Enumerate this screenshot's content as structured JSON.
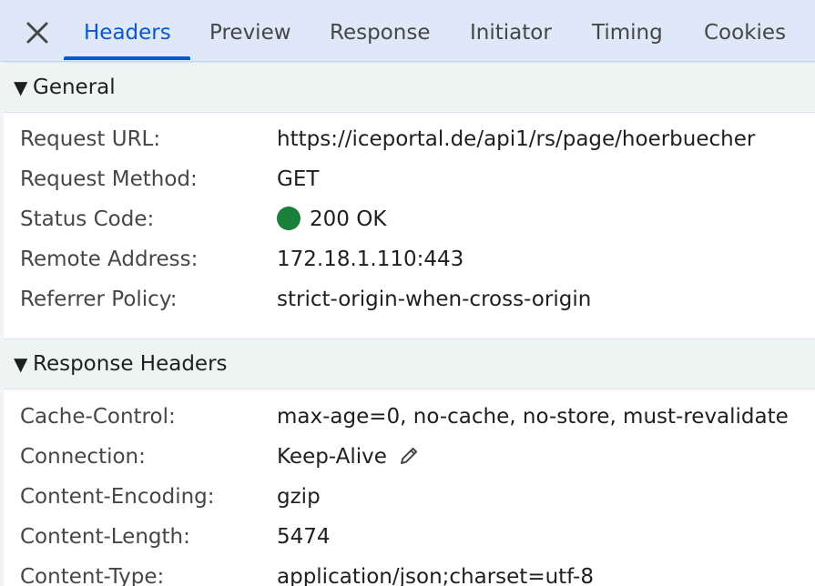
{
  "tabs": [
    {
      "label": "Headers"
    },
    {
      "label": "Preview"
    },
    {
      "label": "Response"
    },
    {
      "label": "Initiator"
    },
    {
      "label": "Timing"
    },
    {
      "label": "Cookies"
    }
  ],
  "general": {
    "title": "General",
    "triangle": "▼",
    "rows": [
      {
        "key": "Request URL:",
        "value": "https://iceportal.de/api1/rs/page/hoerbuecher"
      },
      {
        "key": "Request Method:",
        "value": "GET"
      },
      {
        "key": "Status Code:",
        "value": "200 OK"
      },
      {
        "key": "Remote Address:",
        "value": "172.18.1.110:443"
      },
      {
        "key": "Referrer Policy:",
        "value": "strict-origin-when-cross-origin"
      }
    ]
  },
  "response_headers": {
    "title": "Response Headers",
    "triangle": "▼",
    "rows": [
      {
        "key": "Cache-Control:",
        "value": "max-age=0, no-cache, no-store, must-revalidate"
      },
      {
        "key": "Connection:",
        "value": "Keep-Alive"
      },
      {
        "key": "Content-Encoding:",
        "value": "gzip"
      },
      {
        "key": "Content-Length:",
        "value": "5474"
      },
      {
        "key": "Content-Type:",
        "value": "application/json;charset=utf-8"
      }
    ]
  },
  "colors": {
    "accent": "#0b57d0",
    "status_ok": "#188038",
    "tabbar_bg": "#dfe8f8",
    "section_bg": "#eef4f1"
  },
  "icons": {
    "close": "close-icon",
    "edit": "pencil-icon",
    "status": "status-dot-icon"
  }
}
